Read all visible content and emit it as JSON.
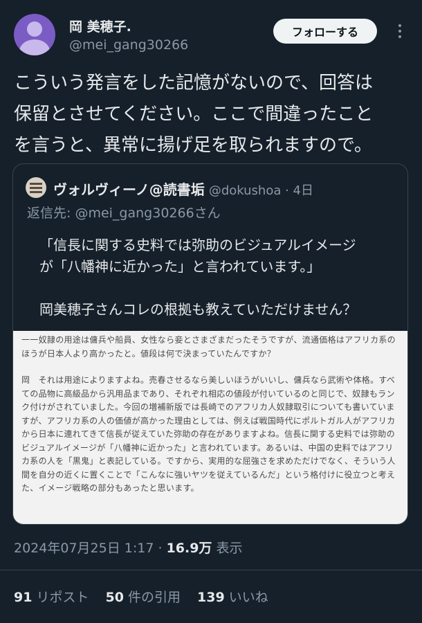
{
  "author": {
    "display_name": "岡 美穂子.",
    "handle": "@mei_gang30266",
    "follow_label": "フォローする",
    "more_icon": "more-icon"
  },
  "tweet": {
    "text": "こういう発言をした記憶がないので、回答は\n保留とさせてください。ここで間違ったこと\nを言うと、異常に揚げ足を取られますので。"
  },
  "quote": {
    "display_name": "ヴォルヴィーノ@読書垢",
    "handle_time": "@dokushoa · 4日",
    "reply_prefix": "返信先: ",
    "reply_handle": "@mei_gang30266さん",
    "text": "「信長に関する史料では弥助のビジュアルイメージ\nが「八幡神に近かった」と言われています。」\n\n岡美穂子さんコレの根拠も教えていただけません？",
    "image_lines": {
      "question": "一一奴隷の用途は傭兵や船員、女性なら妾とさまざまだったそうですが、流通価格はアフリカ系のほうが日本人より高かったと。値段は何で決まっていたんですか？",
      "answer": "岡　それは用途によりますよね。売春させるなら美しいほうがいいし、傭兵なら武術や体格。すべての品物に高級品から汎用品まであり、それぞれ相応の値段が付いているのと同じで、奴隷もランク付けがされていました。今回の増補新版では長崎でのアフリカ人奴隷取引についても書いていますが、アフリカ系の人の価値が高かった理由としては、例えば戦国時代にポルトガル人がアフリカから日本に連れてきて信長が従えていた弥助の存在がありますよね。信長に関する史料では弥助のビジュアルイメージが「八幡神に近かった」と言われています。あるいは、中国の史料ではアフリカ系の人を「黒鬼」と表記している。ですから、実用的な屈強さを求めただけでなく、そういう人間を自分の近くに置くことで「こんなに強いヤツを従えているんだ」という格付けに役立つと考えた、イメージ戦略の部分もあったと思います。"
    }
  },
  "meta": {
    "timestamp": "2024年07月25日 1:17 · ",
    "views_count": "16.9万",
    "views_label": " 表示"
  },
  "stats": {
    "reposts_count": "91",
    "reposts_label": "リポスト",
    "quotes_count": "50",
    "quotes_label": "件の引用",
    "likes_count": "139",
    "likes_label": "いいね"
  },
  "colors": {
    "background": "#15202b",
    "text": "#e7e9ea",
    "secondary": "#8b98a5",
    "border": "#38444d"
  }
}
